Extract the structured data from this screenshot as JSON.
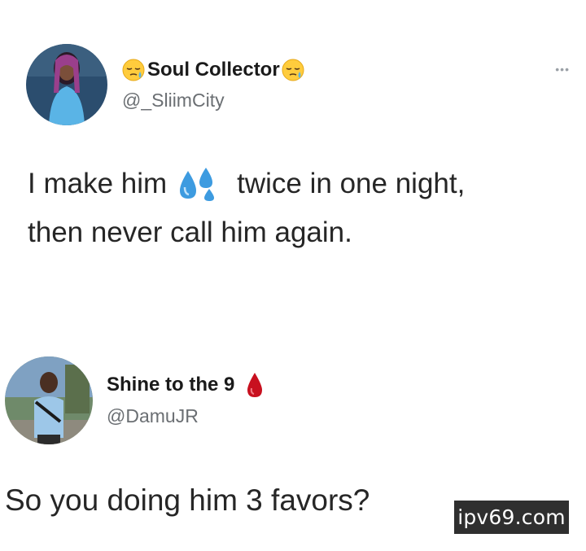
{
  "tweet": {
    "display_name": "Soul Collector",
    "handle": "@_SliimCity",
    "name_emoji_left": "sleepy-face-emoji",
    "name_emoji_right": "sleepy-face-emoji",
    "text_part1": "I make him",
    "text_emoji": "sweat-droplets-emoji",
    "text_part2": "twice in one night,",
    "text_line2": "then never call him again.",
    "more_icon": "more-options-icon"
  },
  "reply": {
    "display_name": "Shine to the 9",
    "handle": "@DamuJR",
    "name_emoji": "drop-of-blood-emoji",
    "text": "So you doing him 3 favors?"
  },
  "watermark": {
    "text": "ipv69.com"
  },
  "colors": {
    "background": "#ffffff",
    "text": "#1c1c1c",
    "handle": "#6b6f73",
    "sweat_drops": "#3d9be0",
    "blood_drop": "#c8101f",
    "watermark_bg": "#2f2f2f"
  }
}
